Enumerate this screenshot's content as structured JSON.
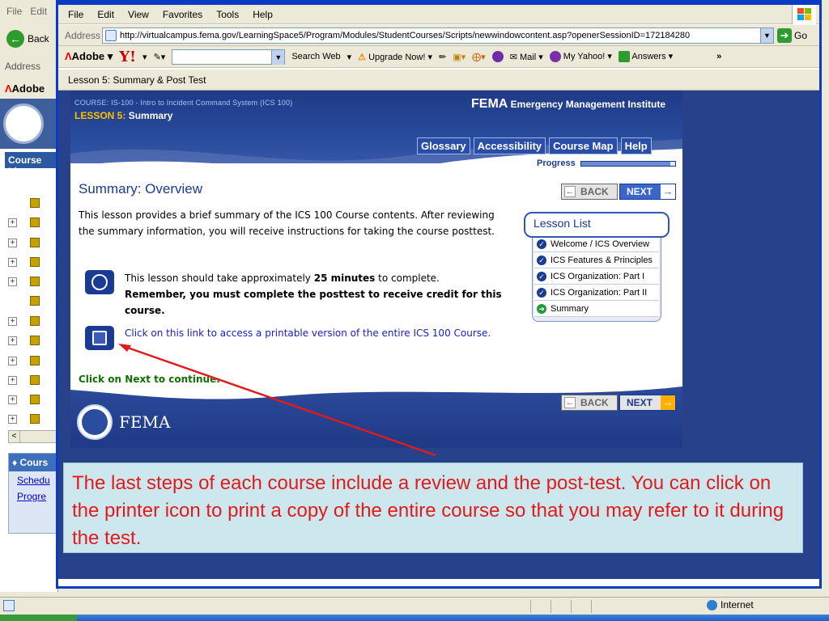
{
  "background_window": {
    "menu": [
      "File",
      "Edit"
    ],
    "back_label": "Back",
    "address_label": "Address",
    "adobe_label": "Adobe",
    "course_list_label": "Course Lis",
    "courses_panel": {
      "title": "Cours",
      "links": [
        "Schedu",
        "Progre"
      ]
    }
  },
  "popup": {
    "menu": [
      "File",
      "Edit",
      "View",
      "Favorites",
      "Tools",
      "Help"
    ],
    "address_label": "Address",
    "url": "http://virtualcampus.fema.gov/LearningSpace5/Program/Modules/StudentCourses/Scripts/newwindowcontent.asp?openerSessionID=172184280",
    "go_label": "Go",
    "toolbar": {
      "adobe_label": "Adobe",
      "yahoo_label": "Y!",
      "search_web_label": "Search Web",
      "upgrade_label": "Upgrade Now!",
      "mail_label": "Mail",
      "my_yahoo_label": "My Yahoo!",
      "answers_label": "Answers",
      "more": "»"
    },
    "lesson_header": "Lesson 5: Summary & Post Test"
  },
  "course": {
    "course_line": "COURSE: IS-100 - Intro to Incident Command System (ICS 100)",
    "lesson_prefix": "LESSON 5:",
    "lesson_name": "Summary",
    "brand_big": "FEMA",
    "brand_small": "Emergency Management Institute",
    "nav": [
      "Glossary",
      "Accessibility",
      "Course Map",
      "Help"
    ],
    "progress_label": "Progress",
    "progress_fraction": 0.95,
    "page_title": "Summary: Overview",
    "intro": "This lesson provides a brief summary of the ICS 100 Course contents. After reviewing the summary information, you will receive instructions for taking the course posttest.",
    "time_pre": "This lesson should take approximately ",
    "time_bold": "25 minutes",
    "time_post": " to complete.",
    "remember": "Remember, you must complete the posttest to receive credit for this course.",
    "print_link": "Click on this link to access a printable version of the entire ICS 100 Course.",
    "continue": "Click on Next to continue.",
    "back_label": "BACK",
    "next_label": "NEXT",
    "footer_brand": "FEMA",
    "lesson_list": {
      "title": "Lesson List",
      "items": [
        {
          "label": "Welcome / ICS Overview",
          "state": "done"
        },
        {
          "label": "ICS Features & Principles",
          "state": "done"
        },
        {
          "label": "ICS Organization: Part I",
          "state": "done"
        },
        {
          "label": "ICS Organization: Part II",
          "state": "done"
        },
        {
          "label": "Summary",
          "state": "current"
        }
      ]
    }
  },
  "annotation": "The last steps of each course include a review and the post-test. You can click on the printer icon to print a copy of the entire course so that you may refer to it during the test.",
  "status": {
    "zone_label": "Internet"
  },
  "colors": {
    "annotation_text": "#e11b1b",
    "annotation_bg": "#cde7ef",
    "fema_blue": "#1a3a94",
    "next_button": "#3a66cc",
    "continue_text": "#117000",
    "arrow": "#e01b1b"
  }
}
